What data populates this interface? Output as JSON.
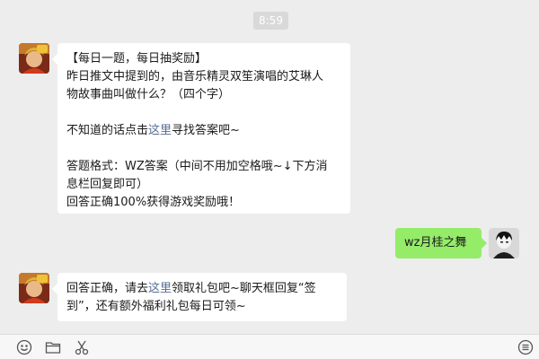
{
  "chat": {
    "timestamp": "8:59",
    "messages": [
      {
        "lines": [
          "【每日一题，每日抽奖励】",
          "昨日推文中提到的，由音乐精灵双笙演唱的艾琳人",
          "物故事曲叫做什么？（四个字）",
          "",
          {
            "before": "不知道的话点击",
            "link": "这里",
            "after": "寻找答案吧~"
          },
          "",
          "答题格式：WZ答案（中间不用加空格哦~↓下方消",
          "息栏回复即可）",
          "回答正确100%获得游戏奖励哦！"
        ]
      },
      {
        "text": "wz月桂之舞"
      },
      {
        "lines": [
          {
            "before": "回答正确，请去",
            "link": "这里",
            "after": "领取礼包吧~聊天框回复“签"
          },
          "到”，还有额外福利礼包每日可领~"
        ]
      }
    ]
  },
  "toolbar": {
    "icons": [
      "emoji-icon",
      "folder-icon",
      "scissors-icon",
      "menu-icon"
    ]
  },
  "colors": {
    "background": "#ededed",
    "bubble_incoming": "#ffffff",
    "bubble_outgoing": "#95ec69",
    "link": "#576b95",
    "timestamp_bg": "#d9d9d9"
  }
}
